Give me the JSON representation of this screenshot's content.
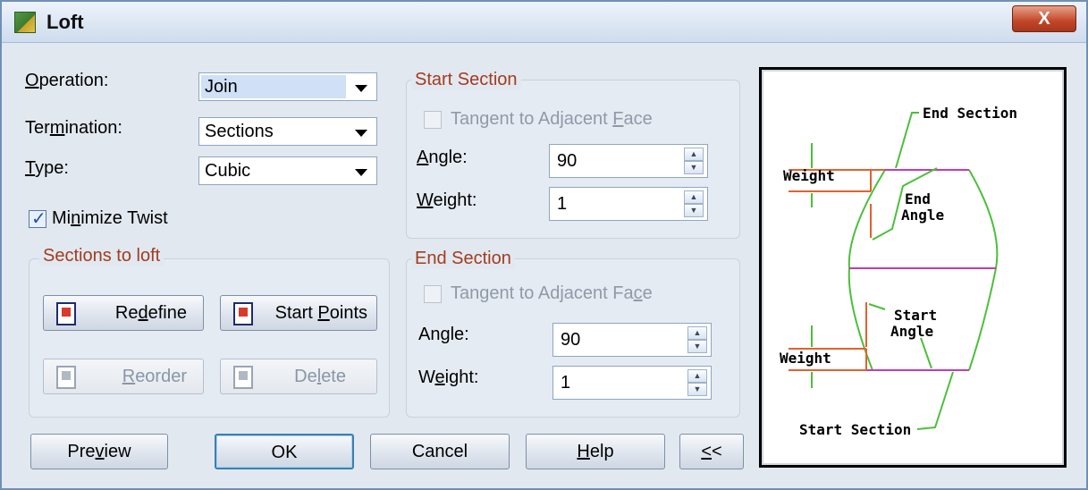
{
  "window": {
    "title": "Loft",
    "close_label": "X"
  },
  "operation": {
    "label_prefix": "",
    "label_mnemonic": "O",
    "label_rest": "peration:",
    "value": "Join"
  },
  "termination": {
    "label_prefix": "Ter",
    "label_mnemonic": "m",
    "label_rest": "ination:",
    "value": "Sections"
  },
  "type": {
    "label_prefix": "",
    "label_mnemonic": "T",
    "label_rest": "ype:",
    "value": "Cubic"
  },
  "minimize_twist": {
    "label_prefix": "Mi",
    "label_mnemonic": "n",
    "label_rest": "imize Twist",
    "checked": true
  },
  "sections_to_loft": {
    "title": "Sections to loft",
    "redefine": {
      "prefix": "Re",
      "mnemonic": "d",
      "rest": "efine"
    },
    "start_points": {
      "prefix": "Start ",
      "mnemonic": "P",
      "rest": "oints"
    },
    "reorder": {
      "prefix": "",
      "mnemonic": "R",
      "rest": "eorder"
    },
    "delete": {
      "prefix": "De",
      "mnemonic": "l",
      "rest": "ete"
    }
  },
  "start_section": {
    "title": "Start Section",
    "tangent": {
      "prefix": "Tangent to Adjacent ",
      "mnemonic": "F",
      "rest": "ace"
    },
    "angle": {
      "prefix": "",
      "mnemonic": "A",
      "rest": "ngle:",
      "value": "90"
    },
    "weight": {
      "prefix": "",
      "mnemonic": "W",
      "rest": "eight:",
      "value": "1"
    }
  },
  "end_section": {
    "title": "End Section",
    "tangent": {
      "prefix": "Tangent to Adjacent Fa",
      "mnemonic": "c",
      "rest": "e"
    },
    "angle": {
      "prefix": "An",
      "mnemonic": "g",
      "rest": "le:",
      "value": "90"
    },
    "weight": {
      "prefix": "W",
      "mnemonic": "e",
      "rest": "ight:",
      "value": "1"
    }
  },
  "buttons": {
    "preview": {
      "prefix": "Pre",
      "mnemonic": "v",
      "rest": "iew"
    },
    "ok": "OK",
    "cancel": "Cancel",
    "help": {
      "prefix": "",
      "mnemonic": "H",
      "rest": "elp"
    },
    "collapse": {
      "prefix": "",
      "mnemonic": "<",
      "rest": "<"
    }
  },
  "diagram": {
    "end_section": "End Section",
    "weight_top": "Weight",
    "end_angle_1": "End",
    "end_angle_2": "Angle",
    "start_angle_1": "Start",
    "start_angle_2": "Angle",
    "weight_bottom": "Weight",
    "start_section": "Start Section"
  },
  "colors": {
    "group_title": "#a23c1f",
    "profile": "#e2612f",
    "section_line": "#c43ab5",
    "leader": "#3fbf2f"
  }
}
